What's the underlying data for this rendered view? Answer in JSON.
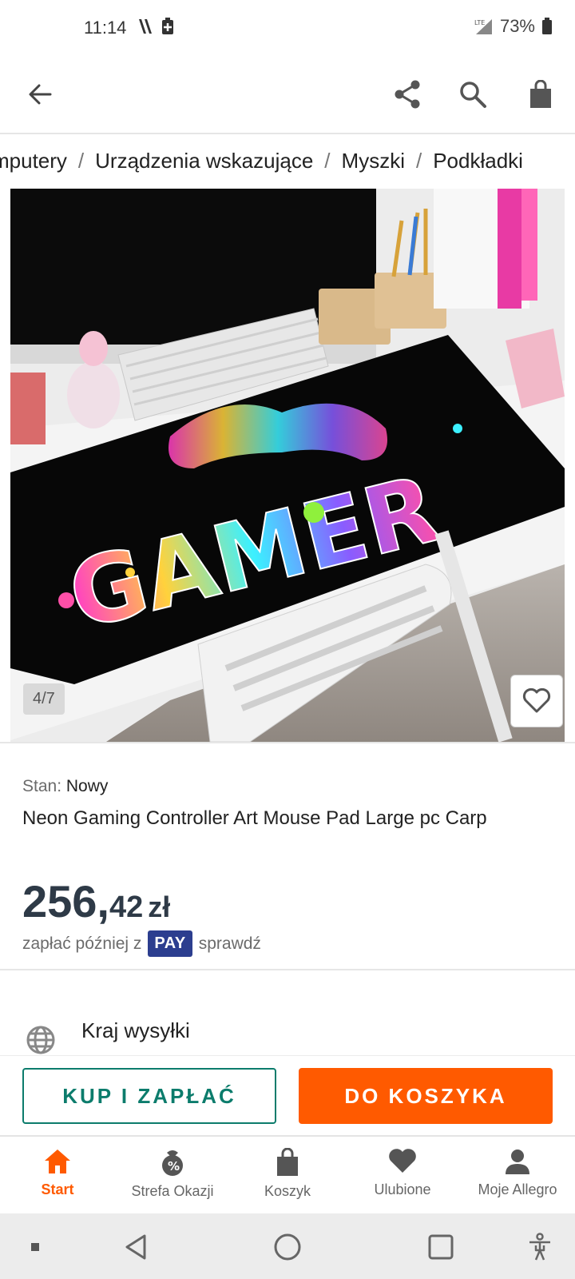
{
  "status_bar": {
    "time": "11:14",
    "network": "LTE",
    "battery": "73%"
  },
  "breadcrumb": [
    "mputery",
    "Urządzenia wskazujące",
    "Myszki",
    "Podkładki"
  ],
  "gallery": {
    "counter": "4/7",
    "image_text": "GAMER"
  },
  "product": {
    "condition_label": "Stan:",
    "condition_value": "Nowy",
    "title": "Neon Gaming Controller Art Mouse Pad Large pc Carp",
    "price_int": "256,",
    "price_dec": "42",
    "currency": "zł",
    "pay_prefix": "zapłać później z",
    "pay_badge": "PAY",
    "pay_link": "sprawdź"
  },
  "shipping": {
    "label": "Kraj wysyłki"
  },
  "actions": {
    "buy_label": "KUP I ZAPŁAĆ",
    "cart_label": "DO KOSZYKA"
  },
  "bottom_nav": [
    "Start",
    "Strefa Okazji",
    "Koszyk",
    "Ulubione",
    "Moje Allegro"
  ],
  "colors": {
    "accent": "#ff5a00",
    "buy_border": "#0c7c6c",
    "price": "#2e3a47",
    "pay_badge": "#2c3e8f"
  }
}
